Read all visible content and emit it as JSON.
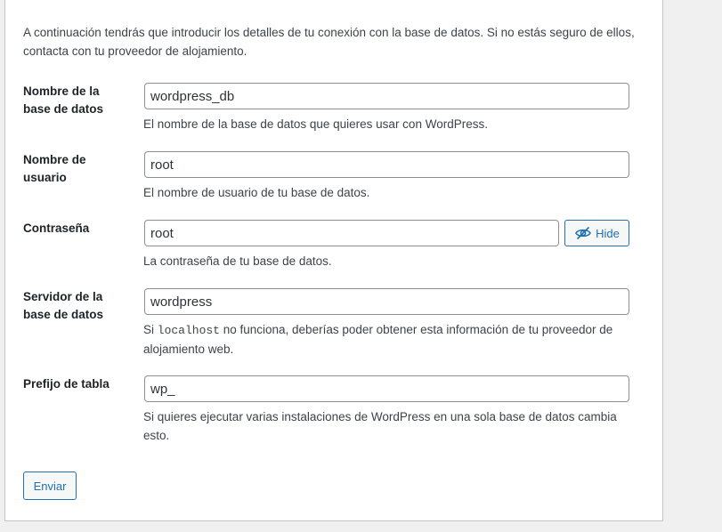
{
  "intro_text": "A continuación tendrás que introducir los detalles de tu conexión con la base de datos. Si no estás seguro de ellos, contacta con tu proveedor de alojamiento.",
  "fields": {
    "dbname": {
      "label": "Nombre de la base de datos",
      "value": "wordpress_db",
      "description": "El nombre de la base de datos que quieres usar con WordPress."
    },
    "uname": {
      "label": "Nombre de usuario",
      "value": "root",
      "description": "El nombre de usuario de tu base de datos."
    },
    "pwd": {
      "label": "Contraseña",
      "value": "root",
      "description": "La contraseña de tu base de datos.",
      "toggle_label": "Hide",
      "toggle_icon": "eye-slash-icon"
    },
    "dbhost": {
      "label": "Servidor de la base de datos",
      "value": "wordpress",
      "description_prefix": "Si ",
      "description_code": "localhost",
      "description_suffix": " no funciona, deberías poder obtener esta información de tu proveedor de alojamiento web."
    },
    "prefix": {
      "label": "Prefijo de tabla",
      "value": "wp_",
      "description": "Si quieres ejecutar varias instalaciones de WordPress en una sola base de datos cambia esto."
    }
  },
  "submit_label": "Enviar",
  "colors": {
    "accent": "#2271b1",
    "background": "#f0f0f1",
    "card": "#ffffff",
    "text": "#3c434a",
    "border": "#8c8f94"
  }
}
